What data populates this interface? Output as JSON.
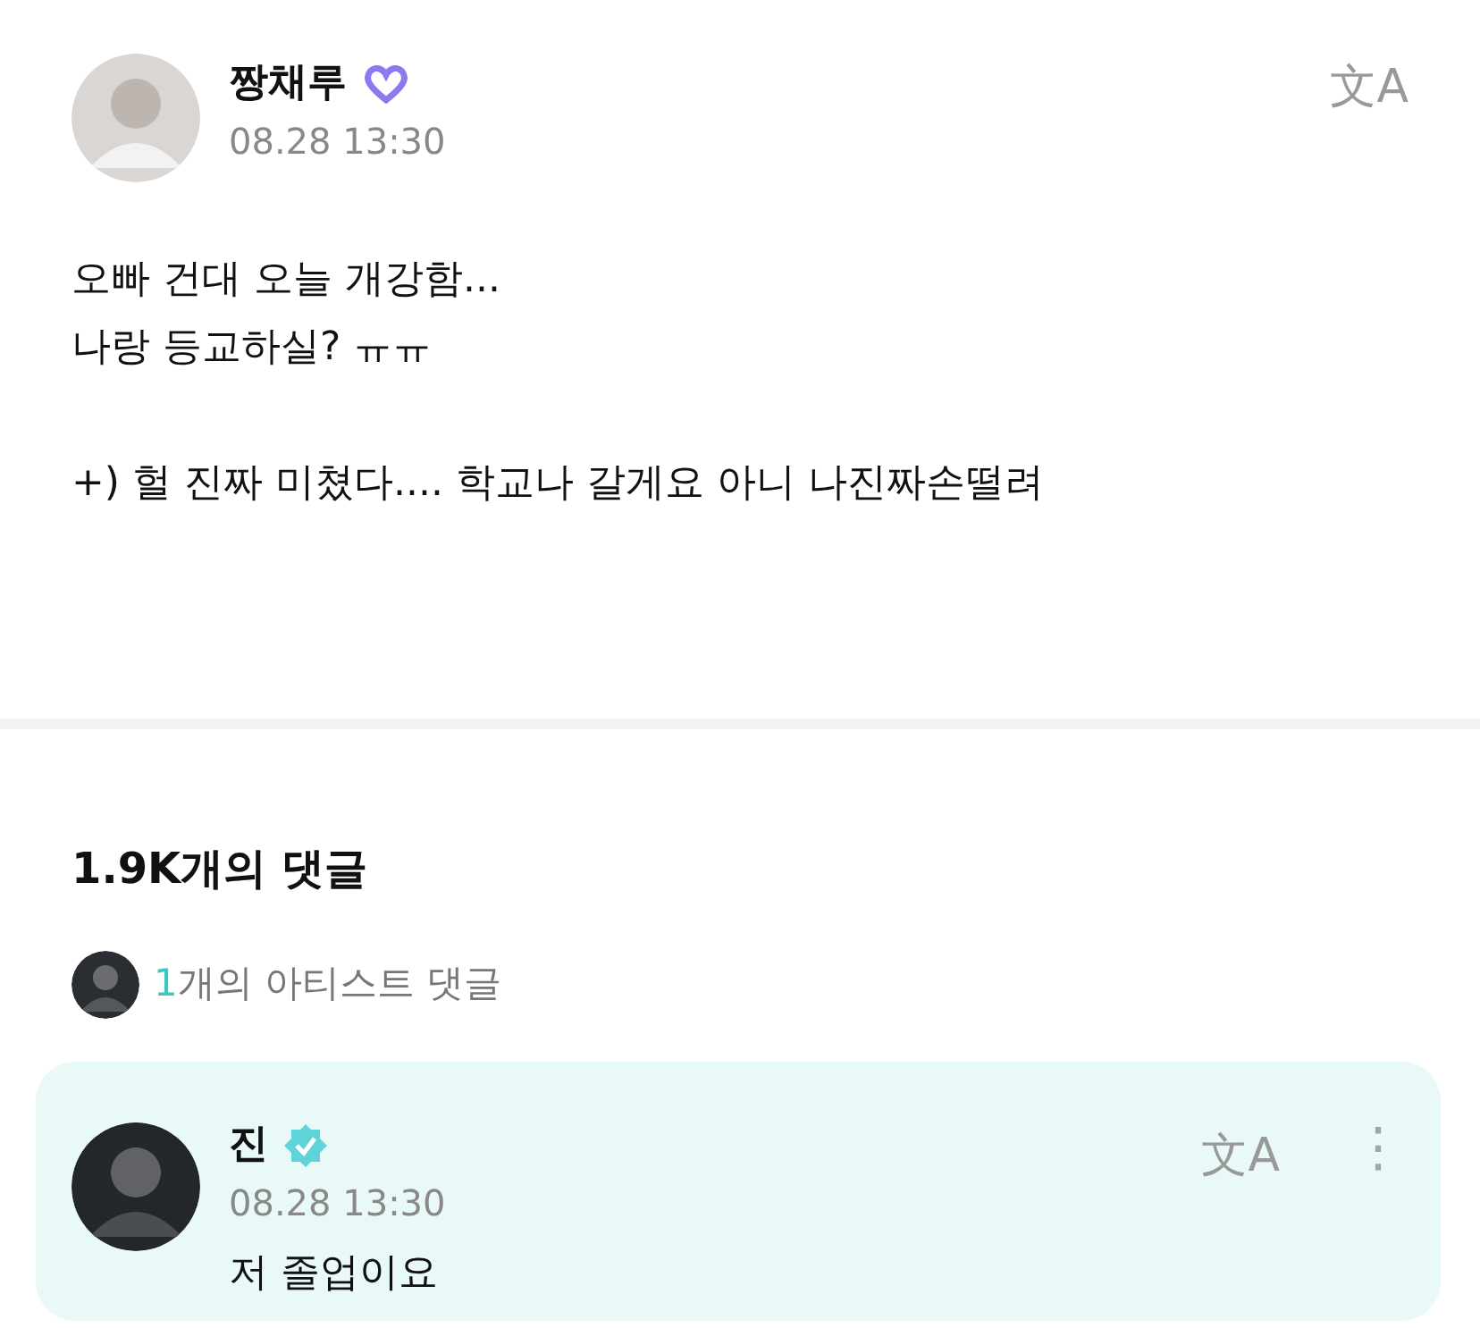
{
  "post": {
    "author": "짱채루",
    "time": "08.28 13:30",
    "translate": "文A",
    "paragraphs": [
      [
        "오빠 건대 오늘 개강함...",
        "나랑 등교하실? ㅠㅠ"
      ],
      [
        "+) 헐 진짜 미쳤다.... 학교나 갈게요 아니 나진짜손떨려"
      ]
    ]
  },
  "comments": {
    "title": "1.9K개의 댓글",
    "artist_count": "1",
    "artist_label": "개의 아티스트 댓글"
  },
  "comment": {
    "author": "진",
    "verified": true,
    "time": "08.28 13:30",
    "translate": "文A",
    "more": "⋮",
    "text": "저 졸업이요"
  }
}
